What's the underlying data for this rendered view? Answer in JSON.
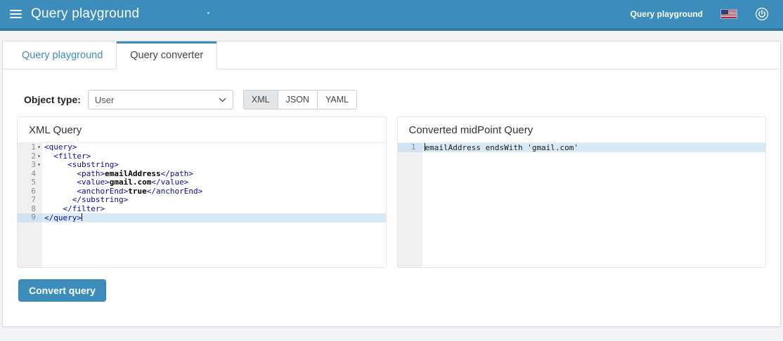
{
  "colors": {
    "navbar": "#3c8dbc",
    "navbar_border": "#36789e",
    "accent": "#3c8dbc",
    "active_line": "#d9eaf7",
    "xml_tag": "#0a0aa0",
    "page_background": "#f4f5f7"
  },
  "header": {
    "title": "Query playground",
    "user_label": "Query playground"
  },
  "tabs": [
    {
      "label": "Query playground"
    },
    {
      "label": "Query converter"
    }
  ],
  "controls": {
    "object_type_label": "Object type:",
    "object_type_value": "User",
    "formats": [
      {
        "label": "XML",
        "selected": true
      },
      {
        "label": "JSON",
        "selected": false
      },
      {
        "label": "YAML",
        "selected": false
      }
    ]
  },
  "panels": {
    "left": {
      "title": "XML Query",
      "lines": [
        {
          "num": 1,
          "fold": true,
          "segments": [
            {
              "c": "tag",
              "s": "<query>"
            }
          ]
        },
        {
          "num": 2,
          "fold": true,
          "segments": [
            {
              "c": "tag",
              "s": "  <filter>"
            }
          ]
        },
        {
          "num": 3,
          "fold": true,
          "segments": [
            {
              "c": "tag",
              "s": "     <substring>"
            }
          ]
        },
        {
          "num": 4,
          "fold": false,
          "segments": [
            {
              "c": "tag",
              "s": "       <path>"
            },
            {
              "c": "bold",
              "s": "emailAddress"
            },
            {
              "c": "tag",
              "s": "</path>"
            }
          ]
        },
        {
          "num": 5,
          "fold": false,
          "segments": [
            {
              "c": "tag",
              "s": "       <value>"
            },
            {
              "c": "bold",
              "s": "gmail.com"
            },
            {
              "c": "tag",
              "s": "</value>"
            }
          ]
        },
        {
          "num": 6,
          "fold": false,
          "segments": [
            {
              "c": "tag",
              "s": "       <anchorEnd>"
            },
            {
              "c": "bold",
              "s": "true"
            },
            {
              "c": "tag",
              "s": "</anchorEnd>"
            }
          ]
        },
        {
          "num": 7,
          "fold": false,
          "segments": [
            {
              "c": "tag",
              "s": "      </substring>"
            }
          ]
        },
        {
          "num": 8,
          "fold": false,
          "segments": [
            {
              "c": "tag",
              "s": "    </filter>"
            }
          ]
        },
        {
          "num": 9,
          "fold": false,
          "active": true,
          "cursor": "after",
          "segments": [
            {
              "c": "tag",
              "s": "</query>"
            }
          ]
        }
      ]
    },
    "right": {
      "title": "Converted midPoint Query",
      "lines": [
        {
          "num": 1,
          "fold": false,
          "active": true,
          "cursor": "before",
          "segments": [
            {
              "c": "plain",
              "s": "emailAddress endsWith 'gmail.com'"
            }
          ]
        }
      ]
    }
  },
  "actions": {
    "convert_label": "Convert query"
  }
}
